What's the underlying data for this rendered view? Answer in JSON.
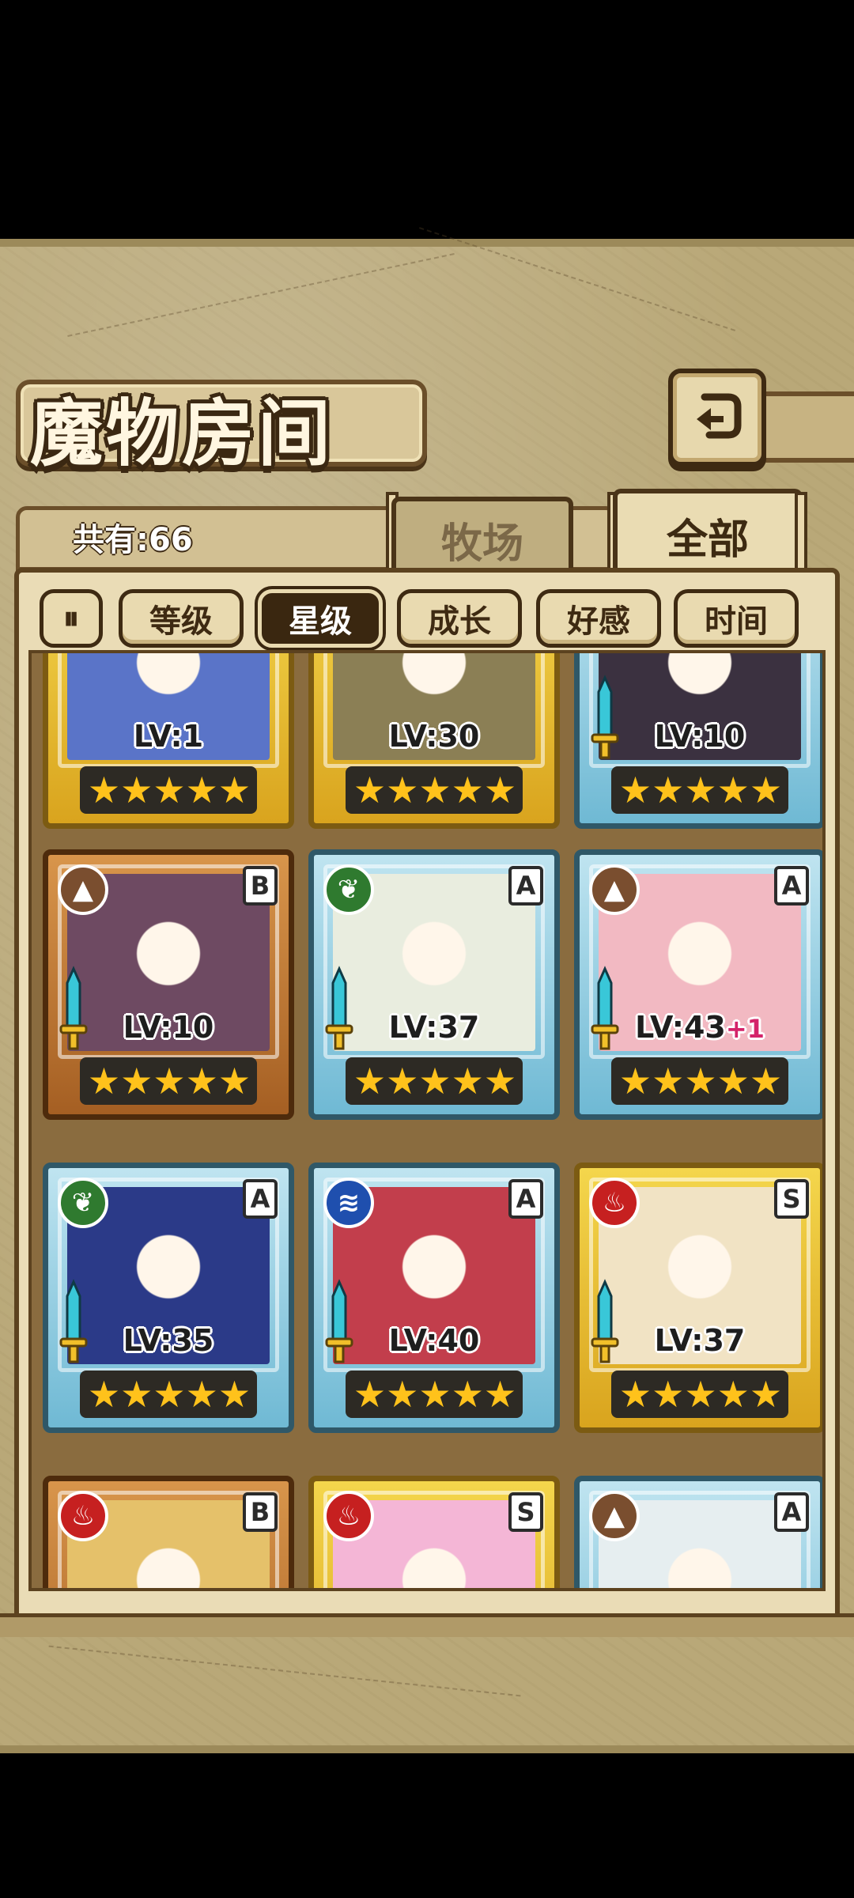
{
  "title": "魔物房间",
  "count_label": "共有:66",
  "tabs": [
    {
      "label": "牧场",
      "active": false
    },
    {
      "label": "全部",
      "active": true
    }
  ],
  "sort": {
    "toggle_icon": "sort-order-icon",
    "buttons": [
      {
        "label": "等级",
        "active": false
      },
      {
        "label": "星级",
        "active": true
      },
      {
        "label": "成长",
        "active": false
      },
      {
        "label": "好感",
        "active": false
      },
      {
        "label": "时间",
        "active": false
      }
    ]
  },
  "cards": [
    {
      "level": "LV:1",
      "plus": "",
      "stars": 5,
      "frame": "gold",
      "element": "",
      "rank": "",
      "sword": false,
      "portrait": "#5a74c8"
    },
    {
      "level": "LV:30",
      "plus": "",
      "stars": 5,
      "frame": "gold",
      "element": "",
      "rank": "",
      "sword": false,
      "portrait": "#8b7f55"
    },
    {
      "level": "LV:10",
      "plus": "",
      "stars": 5,
      "frame": "blue",
      "element": "",
      "rank": "",
      "sword": true,
      "portrait": "#3b3140"
    },
    {
      "level": "LV:10",
      "plus": "",
      "stars": 5,
      "frame": "bronze",
      "element": "earth",
      "rank": "B",
      "sword": true,
      "portrait": "#6e4a62"
    },
    {
      "level": "LV:37",
      "plus": "",
      "stars": 5,
      "frame": "blue",
      "element": "leaf",
      "rank": "A",
      "sword": true,
      "portrait": "#e9eddf"
    },
    {
      "level": "LV:43",
      "plus": "+1",
      "stars": 5,
      "frame": "blue",
      "element": "earth",
      "rank": "A",
      "sword": true,
      "portrait": "#f2b9c2"
    },
    {
      "level": "LV:35",
      "plus": "",
      "stars": 5,
      "frame": "blue",
      "element": "leaf",
      "rank": "A",
      "sword": true,
      "portrait": "#2b3a88"
    },
    {
      "level": "LV:40",
      "plus": "",
      "stars": 5,
      "frame": "blue",
      "element": "water",
      "rank": "A",
      "sword": true,
      "portrait": "#c23e4c"
    },
    {
      "level": "LV:37",
      "plus": "",
      "stars": 5,
      "frame": "gold",
      "element": "fire",
      "rank": "S",
      "sword": true,
      "portrait": "#f1e3c4"
    },
    {
      "level": "",
      "plus": "",
      "stars": 0,
      "frame": "bronze",
      "element": "fire",
      "rank": "B",
      "sword": false,
      "portrait": "#e5c16a"
    },
    {
      "level": "",
      "plus": "",
      "stars": 0,
      "frame": "gold",
      "element": "fire",
      "rank": "S",
      "sword": false,
      "portrait": "#f4b6d6"
    },
    {
      "level": "",
      "plus": "",
      "stars": 0,
      "frame": "blue",
      "element": "earth",
      "rank": "A",
      "sword": false,
      "portrait": "#e6eef0"
    }
  ],
  "icons": {
    "back": "back-arrow-icon",
    "star": "star-icon",
    "sword": "sword-icon"
  }
}
